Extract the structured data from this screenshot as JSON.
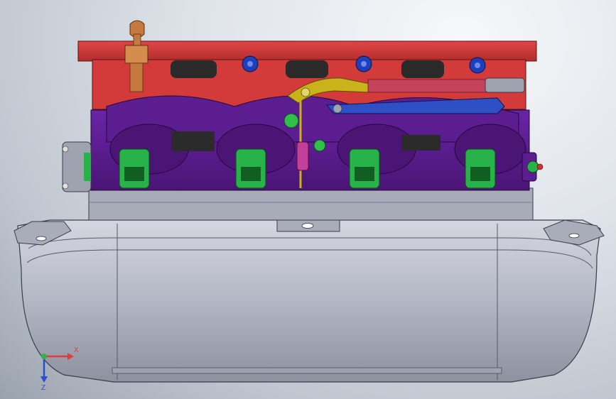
{
  "viewport": {
    "background": "#dfe4ea"
  },
  "model": {
    "colors": {
      "flange": "#d33a3a",
      "flange_dark": "#8e1f1f",
      "manifold": "#5b1d8f",
      "manifold_dark": "#33104f",
      "injector": "#27b34a",
      "injector_dark": "#115e22",
      "plenum": "#b9bcc8",
      "plenum_dark": "#6f7382",
      "bolt_blue": "#1e3fb8",
      "linkage_yellow": "#c9b21a",
      "spring_red": "#c4425a",
      "knob": "#c47a3f"
    },
    "injectors": [
      "injector-1",
      "injector-2",
      "injector-3",
      "injector-4"
    ],
    "flange_bolts": [
      "bolt-1",
      "bolt-2",
      "bolt-3",
      "bolt-4"
    ]
  },
  "triad": {
    "x_label": "X",
    "z_label": "Z",
    "x_color": "#e23b3b",
    "y_color": "#2fb34a",
    "z_color": "#2b4fd1"
  }
}
